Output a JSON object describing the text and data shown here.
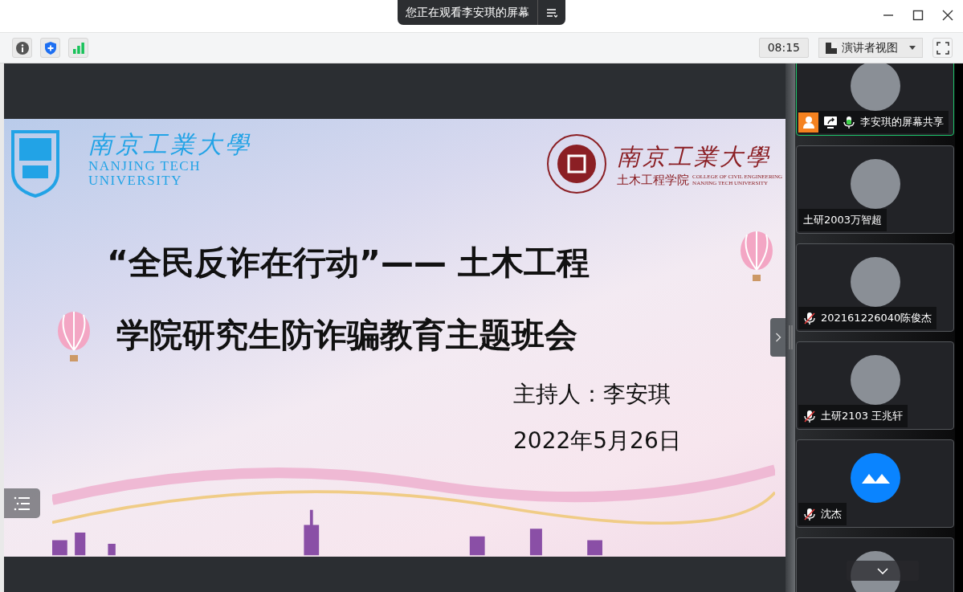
{
  "banner": {
    "text": "您正在观看李安琪的屏幕"
  },
  "toolbar": {
    "timer": "08:15",
    "view_button": "演讲者视图"
  },
  "slide": {
    "left_logo": {
      "chinese": "南京工業大學",
      "english_lines": [
        "NANJING TECH",
        "UNIVERSITY"
      ]
    },
    "right_logo": {
      "chinese": "南京工業大學",
      "college": "土木工程学院",
      "english_lines": [
        "COLLEGE OF CIVIL ENGINEERING",
        "NANJING TECH UNIVERSITY"
      ]
    },
    "title_lines": [
      "“全民反诈在行动”—— 土木工程",
      "学院研究生防诈骗教育主题班会"
    ],
    "host": "主持人：李安琪",
    "date": "2022年5月26日"
  },
  "participants": [
    {
      "name": "李安琪的屏幕共享",
      "selected": true,
      "muted": false,
      "host": true,
      "sharing": true,
      "kind": "photo"
    },
    {
      "name": "土研2003万智超",
      "selected": false,
      "kind": "photo"
    },
    {
      "name": "202161226040陈俊杰",
      "selected": false,
      "muted": true,
      "kind": "photo"
    },
    {
      "name": "土研2103 王兆轩",
      "selected": false,
      "muted": true,
      "kind": "photo"
    },
    {
      "name": "沈杰",
      "selected": false,
      "muted": true,
      "kind": "logo"
    },
    {
      "selected": false,
      "kind": "photo"
    }
  ]
}
